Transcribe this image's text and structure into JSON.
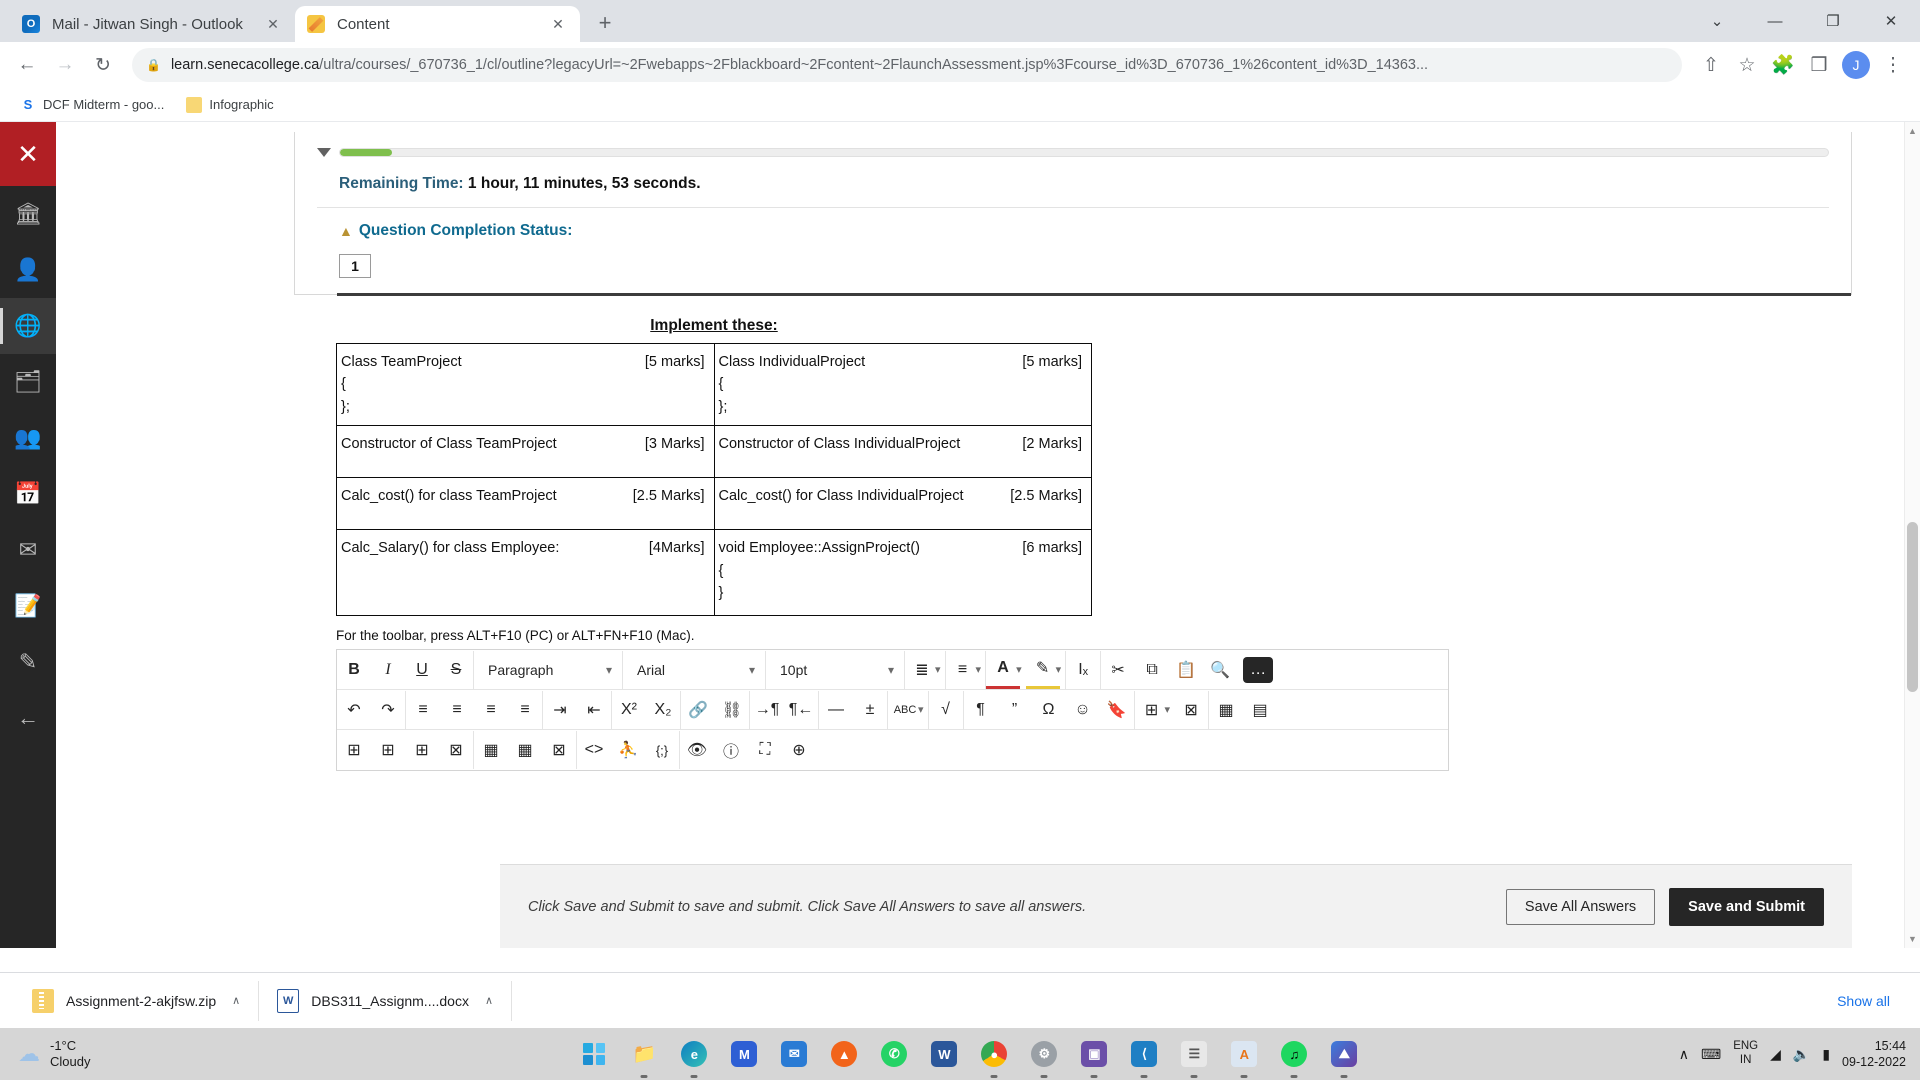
{
  "browser": {
    "tabs": [
      {
        "title": "Mail - Jitwan Singh - Outlook",
        "favicon": "outlook-icon",
        "close": "✕",
        "active": false
      },
      {
        "title": "Content",
        "favicon": "content-icon",
        "close": "✕",
        "active": true
      }
    ],
    "new_tab_label": "+",
    "window_controls": {
      "minimize_all": "⌄",
      "minimize": "—",
      "maximize": "❐",
      "close": "✕"
    },
    "nav": {
      "back": "←",
      "forward": "→",
      "reload": "↻"
    },
    "address": {
      "lock_icon": "🔒",
      "domain": "learn.senecacollege.ca",
      "path": "/ultra/courses/_670736_1/cl/outline?legacyUrl=~2Fwebapps~2Fblackboard~2Fcontent~2FlaunchAssessment.jsp%3Fcourse_id%3D_670736_1%26content_id%3D_14363...",
      "share_icon": "⇧",
      "star_icon": "☆",
      "extensions_icon": "🧩",
      "sidepanel_icon": "❒",
      "profile_initial": "J",
      "menu_icon": "⋮"
    },
    "bookmarks": [
      {
        "label": "DCF Midterm - goo...",
        "icon": "seneca-icon"
      },
      {
        "label": "Infographic",
        "icon": "folder-icon"
      }
    ]
  },
  "rail": {
    "close_label": "✕",
    "items": [
      {
        "name": "institution-page",
        "glyph": "🏛"
      },
      {
        "name": "profile",
        "glyph": "👤"
      },
      {
        "name": "courses",
        "glyph": "🌐"
      },
      {
        "name": "organizations",
        "glyph": "🗂"
      },
      {
        "name": "groups",
        "glyph": "👥"
      },
      {
        "name": "calendar",
        "glyph": "📅"
      },
      {
        "name": "messages",
        "glyph": "✉"
      },
      {
        "name": "grades",
        "glyph": "📝"
      },
      {
        "name": "tools",
        "glyph": "✎"
      },
      {
        "name": "sign-out",
        "glyph": "←"
      }
    ]
  },
  "quiz": {
    "progress_percent": 3.5,
    "remaining_time_label": "Remaining Time:",
    "remaining_time_value": "1 hour, 11 minutes, 53 seconds.",
    "completion_status_label": "Question Completion Status:",
    "question_numbers": [
      "1"
    ],
    "question_title": "Implement these:",
    "table_rows": [
      {
        "left": {
          "lines": [
            "Class TeamProject",
            "{",
            "};"
          ],
          "marks": "[5 marks]"
        },
        "right": {
          "lines": [
            "Class IndividualProject",
            "{",
            "};"
          ],
          "marks": "[5 marks]"
        }
      },
      {
        "left": {
          "lines": [
            "Constructor of Class TeamProject"
          ],
          "marks": "[3 Marks]"
        },
        "right": {
          "lines": [
            "Constructor of Class IndividualProject"
          ],
          "marks": "[2 Marks]"
        }
      },
      {
        "left": {
          "lines": [
            "Calc_cost() for class TeamProject"
          ],
          "marks": "[2.5 Marks]"
        },
        "right": {
          "lines": [
            "Calc_cost() for Class IndividualProject"
          ],
          "marks": "[2.5 Marks]"
        }
      },
      {
        "left": {
          "lines": [
            "Calc_Salary() for class Employee:"
          ],
          "marks": "[4Marks]"
        },
        "right": {
          "lines": [
            "void Employee::AssignProject()",
            "{",
            "}"
          ],
          "marks": "[6 marks]"
        }
      }
    ],
    "toolbar_hint": "For the toolbar, press ALT+F10 (PC) or ALT+FN+F10 (Mac)."
  },
  "editor": {
    "row1": {
      "bold": "B",
      "italic": "I",
      "underline": "U",
      "strikethrough": "S",
      "paragraph_value": "Paragraph",
      "font_value": "Arial",
      "size_value": "10pt",
      "bullet_list": "☰",
      "numbered_list": "≡",
      "text_color": "A",
      "highlight": "✎",
      "clear_format": "Iₓ",
      "cut": "✂",
      "copy": "⧉",
      "paste": "📋",
      "find": "🔍",
      "more": "…",
      "caret": "⌄"
    },
    "row2": {
      "undo": "↶",
      "redo": "↷",
      "align_left": "≡",
      "align_center": "≡",
      "align_right": "≡",
      "justify": "≡",
      "indent": "⇥",
      "outdent": "⇤",
      "superscript": "X²",
      "subscript": "X₂",
      "link": "🔗",
      "unlink": "⛓",
      "ltr": "¶",
      "rtl": "¶",
      "hr": "—",
      "insert": "±",
      "spellcheck": "ABC",
      "sqrt": "√",
      "pilcrow": "¶",
      "quote": "”",
      "omega": "Ω",
      "emoji": "☺",
      "bookmark": "🔖",
      "table": "⊞",
      "table_delete": "⊠",
      "table_row": "▦",
      "table_col": "▤"
    },
    "row3": {
      "cell1": "⊞",
      "cell2": "⊞",
      "cell3": "⊞",
      "cell4": "⊠",
      "cell5": "▦",
      "cell6": "▦",
      "cell7": "⊠",
      "code": "<>",
      "accessibility": "⛹",
      "script": "{;}",
      "preview": "👁",
      "help": "?",
      "fullscreen": "⛶",
      "add": "⊕"
    }
  },
  "savebar": {
    "hint": "Click Save and Submit to save and submit. Click Save All Answers to save all answers.",
    "save_all_label": "Save All Answers",
    "save_submit_label": "Save and Submit"
  },
  "downloads": [
    {
      "name": "Assignment-2-akjfsw.zip",
      "icon": "zip-icon",
      "caret": "∧"
    },
    {
      "name": "DBS311_Assignm....docx",
      "icon": "docx-icon",
      "caret": "∧"
    }
  ],
  "downloads_showall": "Show all",
  "taskbar": {
    "weather_temp": "-1°C",
    "weather_cond": "Cloudy",
    "apps": [
      {
        "name": "start",
        "glyph": ""
      },
      {
        "name": "file-explorer",
        "glyph": "🗂"
      },
      {
        "name": "edge",
        "glyph": "e"
      },
      {
        "name": "app-m",
        "glyph": "M"
      },
      {
        "name": "mail",
        "glyph": "✉"
      },
      {
        "name": "brave",
        "glyph": "🦁"
      },
      {
        "name": "whatsapp",
        "glyph": "✆"
      },
      {
        "name": "word",
        "glyph": "W"
      },
      {
        "name": "chrome",
        "glyph": "◉"
      },
      {
        "name": "settings",
        "glyph": "⚙"
      },
      {
        "name": "app-store",
        "glyph": "▣"
      },
      {
        "name": "vscode",
        "glyph": "⌨"
      },
      {
        "name": "notepad",
        "glyph": "🗒"
      },
      {
        "name": "acrobat",
        "glyph": "A"
      },
      {
        "name": "spotify",
        "glyph": "♫"
      },
      {
        "name": "photos",
        "glyph": "🏞"
      }
    ],
    "tray_up": "∧",
    "keyboard_icon": "⌨",
    "wifi_icon": "◠",
    "volume_icon": "🔊",
    "battery_icon": "▭",
    "lang_line1": "ENG",
    "lang_line2": "IN",
    "time": "15:44",
    "date": "09-12-2022"
  }
}
